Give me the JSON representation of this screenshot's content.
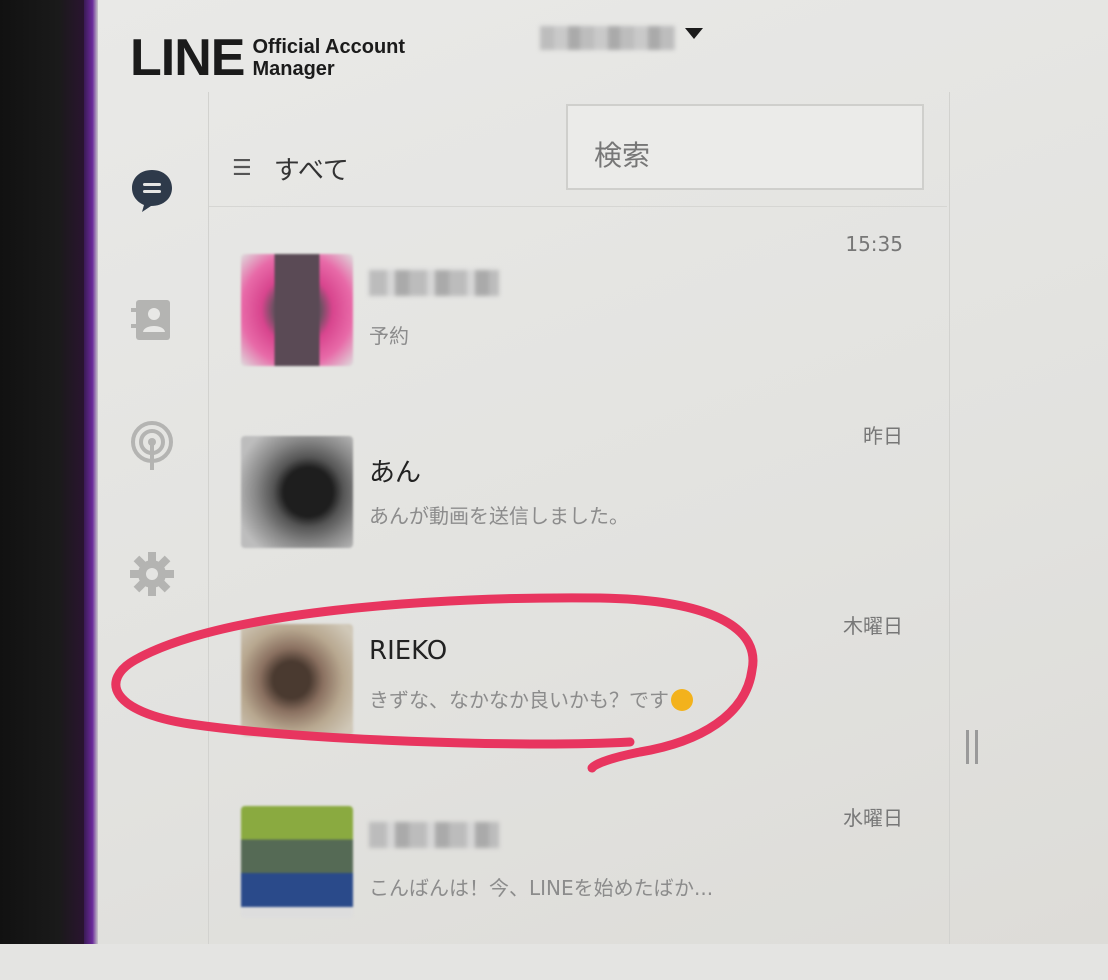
{
  "header": {
    "logo_main": "LINE",
    "logo_sub_line1": "Official Account",
    "logo_sub_line2": "Manager"
  },
  "sidebar": {
    "icons": [
      "chat-icon",
      "contacts-icon",
      "broadcast-icon",
      "gear-icon"
    ]
  },
  "toolbar": {
    "filter_label": "すべて",
    "search_placeholder": "検索"
  },
  "chats": [
    {
      "name": "",
      "message": "予約",
      "time": "15:35"
    },
    {
      "name": "あん",
      "message": "あんが動画を送信しました。",
      "time": "昨日"
    },
    {
      "name": "RIEKO",
      "message": "きずな、なかなか良いかも？です",
      "time": "木曜日"
    },
    {
      "name": "",
      "message": "こんばんは！今、LINEを始めたばか...",
      "time": "水曜日"
    }
  ],
  "colors": {
    "annotation": "#e8355f",
    "text_primary": "#222222",
    "text_secondary": "#8c8c8c"
  }
}
